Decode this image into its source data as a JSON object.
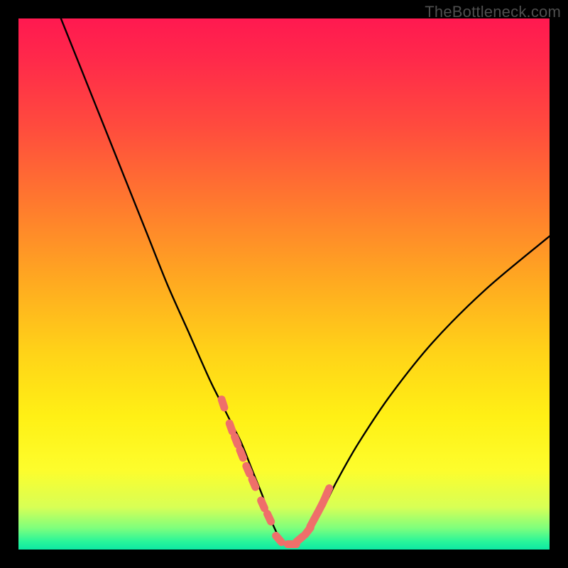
{
  "watermark": "TheBottleneck.com",
  "chart_data": {
    "type": "line",
    "title": "",
    "xlabel": "",
    "ylabel": "",
    "xlim": [
      0,
      100
    ],
    "ylim": [
      0,
      100
    ],
    "grid": false,
    "legend": false,
    "series": [
      {
        "name": "bottleneck-curve",
        "color": "#000000",
        "x": [
          8,
          12,
          16,
          20,
          24,
          28,
          32,
          36,
          38,
          40,
          42,
          44,
          46,
          47,
          48,
          49,
          50,
          51,
          52,
          53,
          54,
          56,
          58,
          60,
          64,
          70,
          78,
          88,
          100
        ],
        "y": [
          100,
          90,
          80,
          70,
          60,
          50,
          41,
          32,
          28,
          24,
          20,
          15,
          10,
          7,
          4.5,
          2.5,
          1.5,
          1,
          1,
          1.5,
          2.5,
          5.5,
          9,
          13,
          20,
          29,
          39,
          49,
          59
        ]
      }
    ],
    "markers": {
      "name": "highlight-points",
      "color": "#ef6f6a",
      "style": "round-cap-segments",
      "x": [
        38.5,
        40.0,
        41.0,
        42.0,
        43.2,
        44.3,
        46.0,
        47.2,
        49.0,
        51.5,
        53.0,
        54.5,
        55.3,
        56.0,
        56.8,
        57.5,
        58.2
      ],
      "y": [
        27.5,
        23.0,
        20.5,
        18.0,
        15.0,
        12.5,
        8.5,
        6.0,
        2.0,
        1.0,
        2.0,
        3.5,
        5.0,
        6.3,
        7.8,
        9.2,
        10.8
      ]
    }
  }
}
